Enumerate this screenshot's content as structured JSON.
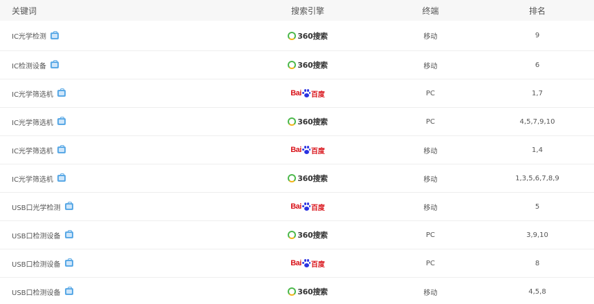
{
  "header": {
    "keyword": "关键词",
    "engine": "搜索引擎",
    "terminal": "终端",
    "rank": "排名"
  },
  "rows": [
    {
      "keyword": "IC光学检测",
      "engine": "360",
      "terminal": "移动",
      "rank": "9"
    },
    {
      "keyword": "IC检测设备",
      "engine": "360",
      "terminal": "移动",
      "rank": "6"
    },
    {
      "keyword": "IC光学筛选机",
      "engine": "baidu",
      "terminal": "PC",
      "rank": "1,7"
    },
    {
      "keyword": "IC光学筛选机",
      "engine": "360",
      "terminal": "PC",
      "rank": "4,5,7,9,10"
    },
    {
      "keyword": "IC光学筛选机",
      "engine": "baidu",
      "terminal": "移动",
      "rank": "1,4"
    },
    {
      "keyword": "IC光学筛选机",
      "engine": "360",
      "terminal": "移动",
      "rank": "1,3,5,6,7,8,9"
    },
    {
      "keyword": "USB口光学检测",
      "engine": "baidu",
      "terminal": "移动",
      "rank": "5"
    },
    {
      "keyword": "USB口检测设备",
      "engine": "360",
      "terminal": "PC",
      "rank": "3,9,10"
    },
    {
      "keyword": "USB口检测设备",
      "engine": "baidu",
      "terminal": "PC",
      "rank": "8"
    },
    {
      "keyword": "USB口检测设备",
      "engine": "360",
      "terminal": "移动",
      "rank": "4,5,8"
    }
  ],
  "logos": {
    "360": {
      "text": "360搜索",
      "icon": "360-logo-icon"
    },
    "baidu": {
      "bai": "Bai",
      "cn": "百度",
      "icon": "baidu-logo-icon"
    }
  },
  "colors": {
    "header_bg": "#f7f7f7",
    "row_border": "#eeeeee",
    "baidu_red": "#d9141b",
    "baidu_blue": "#2932e1",
    "green_360": "#4cb84c",
    "icon_blue": "#5aa9e6"
  }
}
